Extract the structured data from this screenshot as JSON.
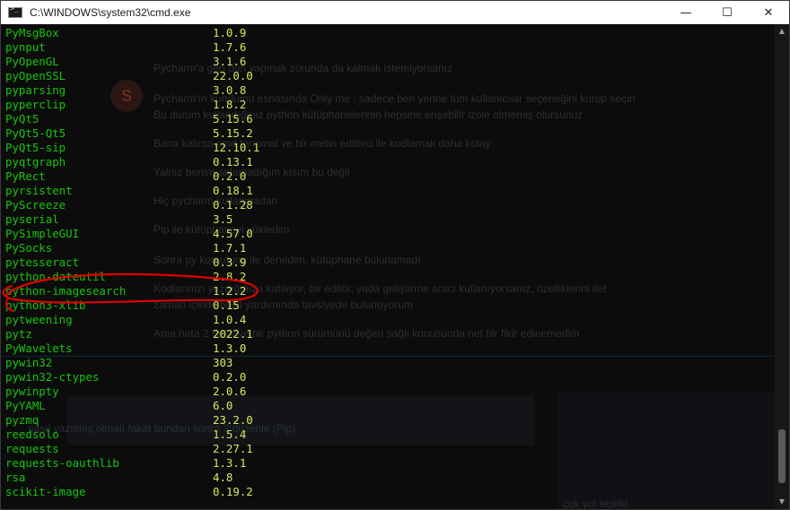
{
  "window": {
    "title": "C:\\WINDOWS\\system32\\cmd.exe",
    "controls": {
      "minimize": "—",
      "maximize": "☐",
      "close": "✕"
    }
  },
  "packages": [
    {
      "name": "PyMsgBox",
      "version": "1.0.9"
    },
    {
      "name": "pynput",
      "version": "1.7.6"
    },
    {
      "name": "PyOpenGL",
      "version": "3.1.6"
    },
    {
      "name": "pyOpenSSL",
      "version": "22.0.0"
    },
    {
      "name": "pyparsing",
      "version": "3.0.8"
    },
    {
      "name": "pyperclip",
      "version": "1.8.2"
    },
    {
      "name": "PyQt5",
      "version": "5.15.6"
    },
    {
      "name": "PyQt5-Qt5",
      "version": "5.15.2"
    },
    {
      "name": "PyQt5-sip",
      "version": "12.10.1"
    },
    {
      "name": "pyqtgraph",
      "version": "0.13.1"
    },
    {
      "name": "PyRect",
      "version": "0.2.0"
    },
    {
      "name": "pyrsistent",
      "version": "0.18.1"
    },
    {
      "name": "PyScreeze",
      "version": "0.1.28"
    },
    {
      "name": "pyserial",
      "version": "3.5"
    },
    {
      "name": "PySimpleGUI",
      "version": "4.57.0"
    },
    {
      "name": "PySocks",
      "version": "1.7.1"
    },
    {
      "name": "pytesseract",
      "version": "0.3.9"
    },
    {
      "name": "python-dateutil",
      "version": "2.8.2"
    },
    {
      "name": "python-imagesearch",
      "version": "1.2.2"
    },
    {
      "name": "python3-xlib",
      "version": "0.15"
    },
    {
      "name": "pytweening",
      "version": "1.0.4"
    },
    {
      "name": "pytz",
      "version": "2022.1"
    },
    {
      "name": "PyWavelets",
      "version": "1.3.0"
    },
    {
      "name": "pywin32",
      "version": "303"
    },
    {
      "name": "pywin32-ctypes",
      "version": "0.2.0"
    },
    {
      "name": "pywinpty",
      "version": "2.0.6"
    },
    {
      "name": "PyYAML",
      "version": "6.0"
    },
    {
      "name": "pyzmq",
      "version": "23.2.0"
    },
    {
      "name": "reedsolo",
      "version": "1.5.4"
    },
    {
      "name": "requests",
      "version": "2.27.1"
    },
    {
      "name": "requests-oauthlib",
      "version": "1.3.1"
    },
    {
      "name": "rsa",
      "version": "4.8"
    },
    {
      "name": "scikit-image",
      "version": "0.19.2"
    }
  ],
  "background_text": [
    "Pycharm'a geri dön yapmak zorunda da kalmak istemiyorsanız",
    "Pycharm'ın kurulumu esnasında Only me , sadece ben yerine tüm kullanıcılar seçeneğini kurup seçin",
    "Bu durum kullandığınız python kütüphanelerinin hepsine erişebilir izole olmemiş olursunuz",
    "Bana kalırsa cmd terminal ve bir metin editörü ile kodlamak daha kolay",
    "Yalnız benim anlamadığım kısım bu değil",
    "Hiç pycharm kullanmadan",
    "Pip ile kütüphaneyi yükledim",
    "Sonra py komutunu ile denedim, kütüphane bulunamadı",
    "Kodlarınızı yazdığınıza katılıyor, bir editör, yada geliştirme aracı kullanıyorsanız, özelliklerini ilet",
    "zaman içinde belki yardımında tavsiyede bulunuyorum",
    "Ama hata 2 farklı ve bir python sürümünü değeri sağlı konusunda net bir fikir edinemedim",
    "nasıl yazılmış olmalı fakat bundan sonra 3 düzenle (Pip)",
    "çok yol tepitki"
  ],
  "colors": {
    "console_bg": "#0c0c0c",
    "package_name": "#16c60c",
    "version": "#d8e85f",
    "annotation": "#e00000"
  }
}
